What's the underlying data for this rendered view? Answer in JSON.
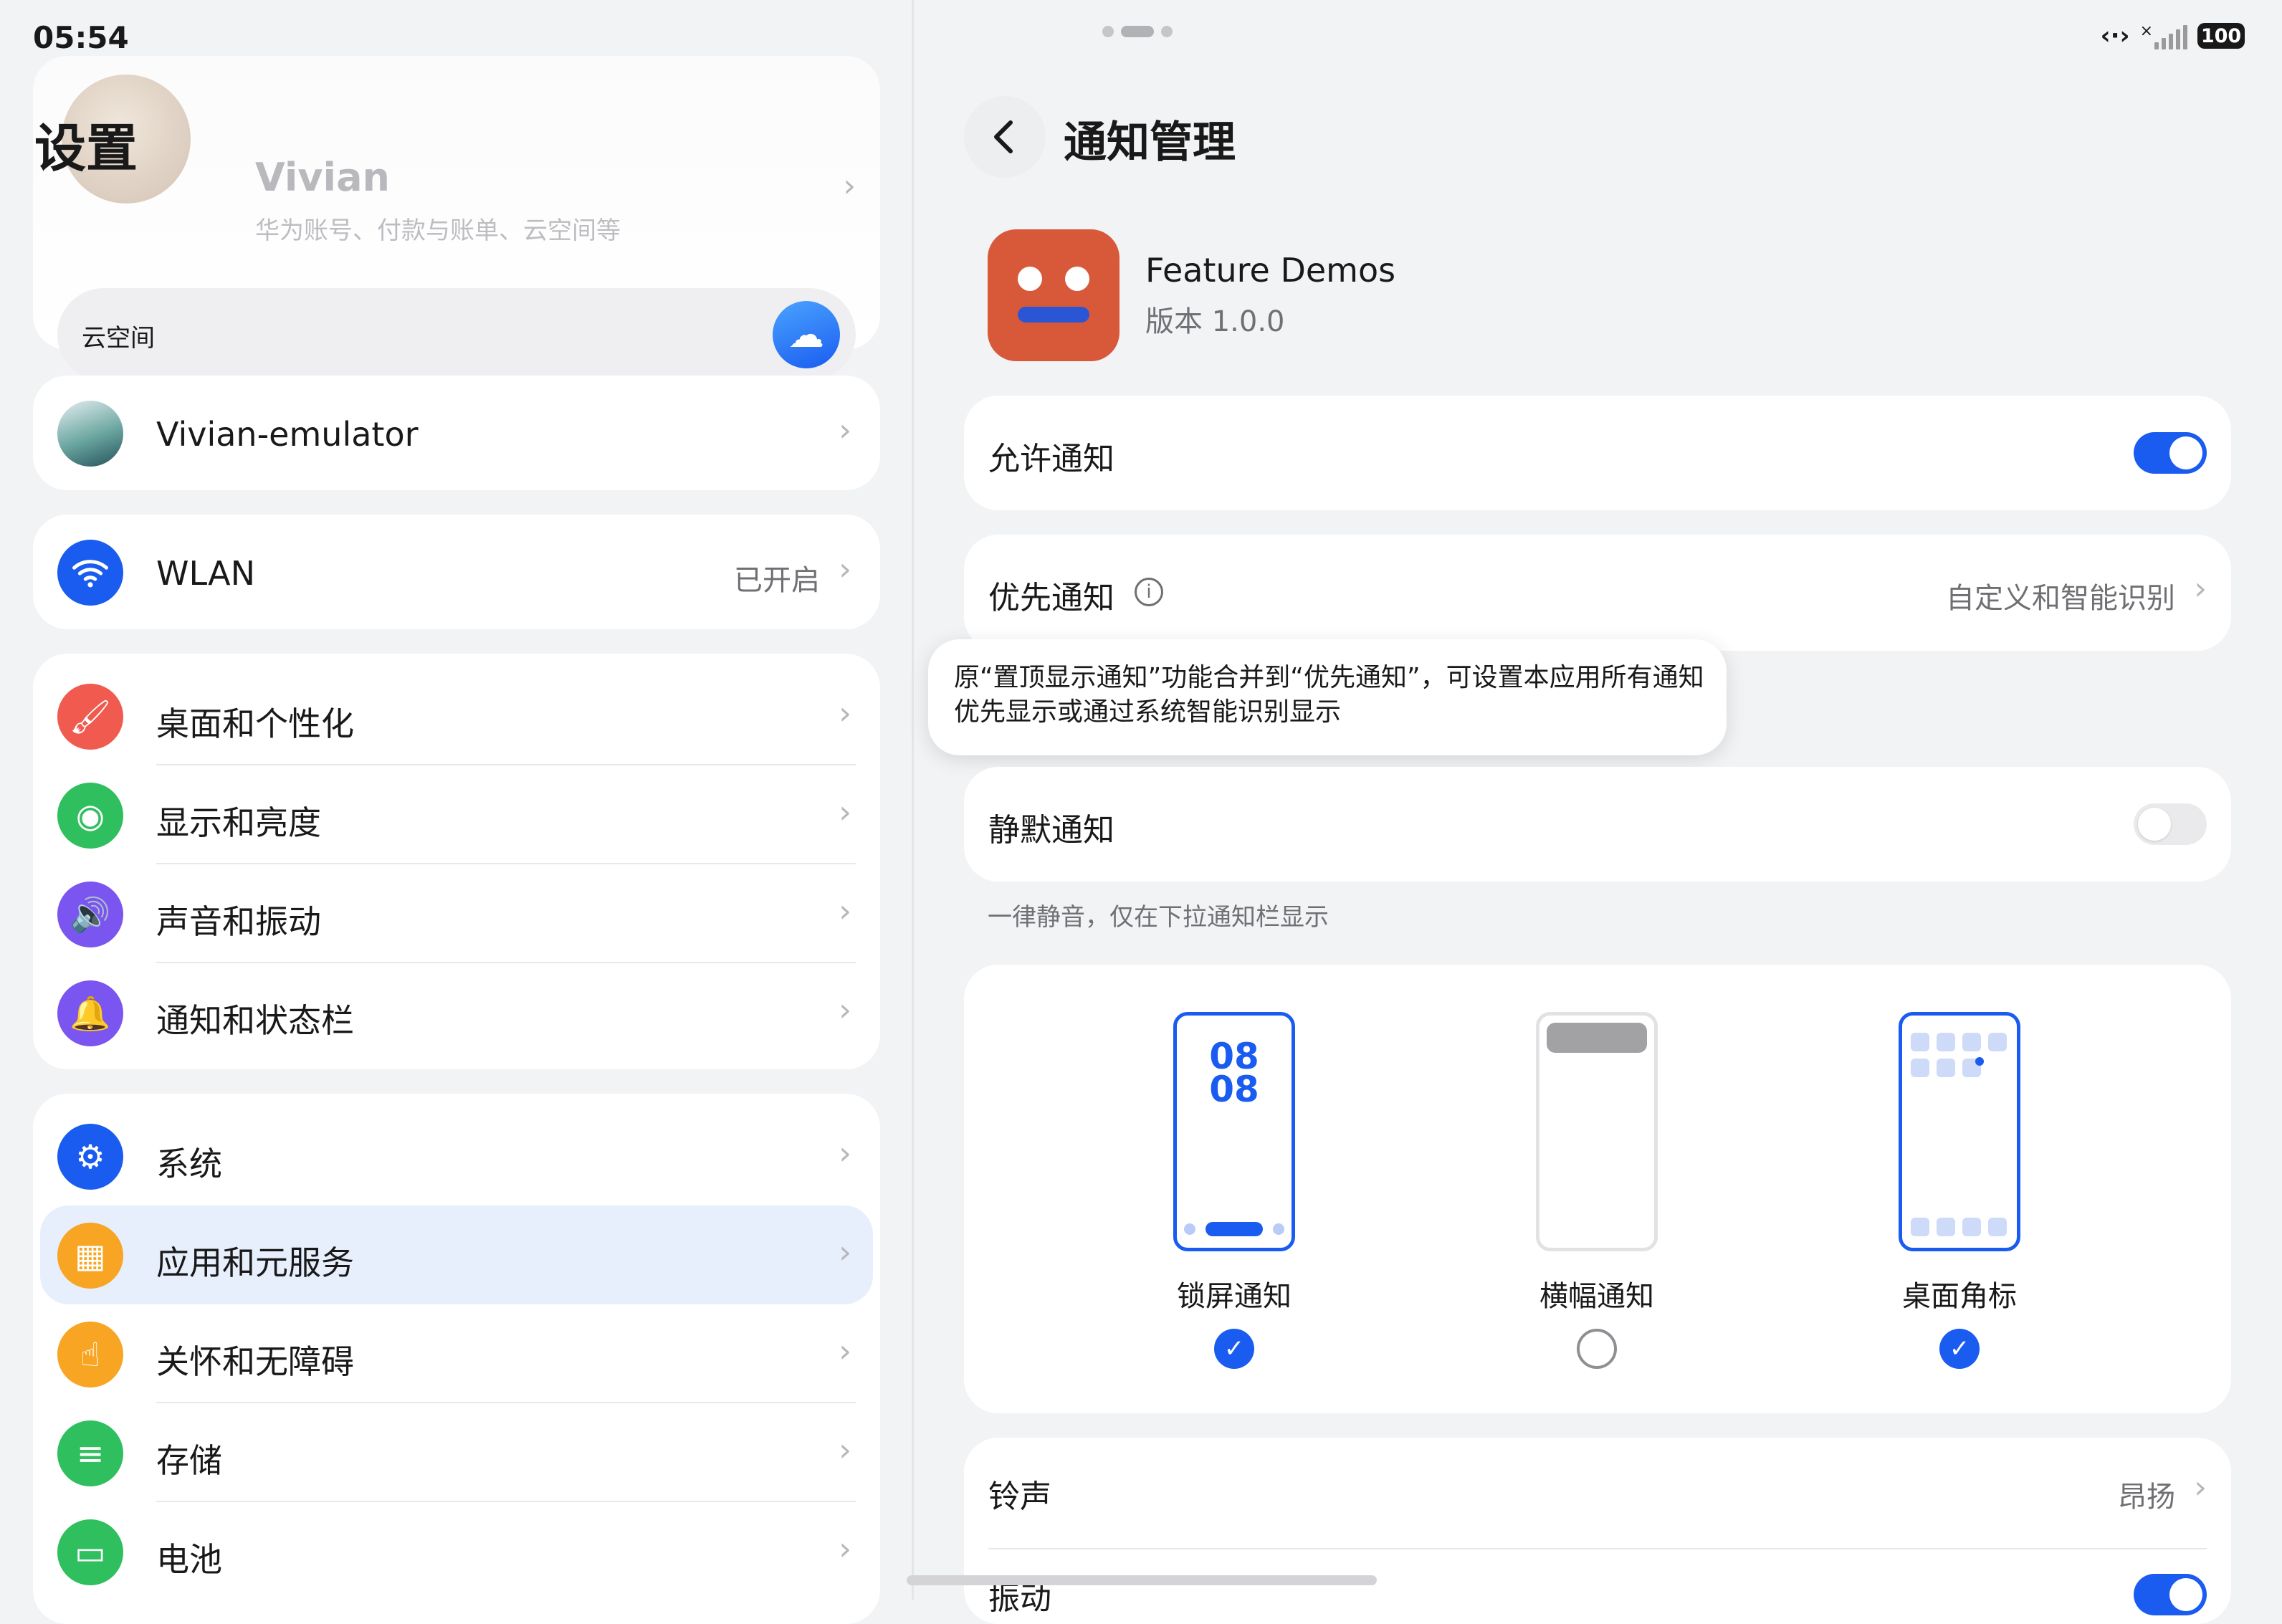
{
  "status_bar": {
    "time": "05:54",
    "battery": "100",
    "signal_mark": "×"
  },
  "left": {
    "title": "设置",
    "account": {
      "name": "Vivian",
      "subtitle": "华为账号、付款与账单、云空间等",
      "cloud_label": "云空间"
    },
    "device": {
      "label": "Vivian-emulator"
    },
    "wlan": {
      "label": "WLAN",
      "value": "已开启"
    },
    "group1": [
      {
        "label": "桌面和个性化",
        "color": "#f05a4f",
        "icon": "brush-icon"
      },
      {
        "label": "显示和亮度",
        "color": "#2fbf5f",
        "icon": "eye-icon"
      },
      {
        "label": "声音和振动",
        "color": "#7b55f0",
        "icon": "speaker-icon"
      },
      {
        "label": "通知和状态栏",
        "color": "#7b55f0",
        "icon": "bell-icon"
      }
    ],
    "group2": [
      {
        "label": "系统",
        "color": "#1a5cf0",
        "icon": "gear-icon"
      },
      {
        "label": "应用和元服务",
        "color": "#f7a523",
        "icon": "apps-icon"
      },
      {
        "label": "关怀和无障碍",
        "color": "#f7a523",
        "icon": "hand-icon"
      },
      {
        "label": "存储",
        "color": "#2fbf5f",
        "icon": "storage-icon"
      },
      {
        "label": "电池",
        "color": "#2fbf5f",
        "icon": "battery-icon"
      }
    ]
  },
  "right": {
    "title": "通知管理",
    "app": {
      "name": "Feature Demos",
      "version": "版本 1.0.0"
    },
    "allow_notifications": {
      "label": "允许通知",
      "on": true
    },
    "priority": {
      "label": "优先通知",
      "value": "自定义和智能识别"
    },
    "tooltip": "原“置顶显示通知”功能合并到“优先通知”，可设置本应用所有通知优先显示或通过系统智能识别显示",
    "silent": {
      "label": "静默通知",
      "on": false,
      "caption": "一律静音，仅在下拉通知栏显示"
    },
    "styles": [
      {
        "label": "锁屏通知",
        "checked": true,
        "clock": "08\n08"
      },
      {
        "label": "横幅通知",
        "checked": false
      },
      {
        "label": "桌面角标",
        "checked": true
      }
    ],
    "ringtone": {
      "label": "铃声",
      "value": "昂扬"
    },
    "vibrate": {
      "label": "振动",
      "on": true
    }
  },
  "colors": {
    "accent": "#1a5cf0",
    "app_icon": "#d8583a"
  }
}
